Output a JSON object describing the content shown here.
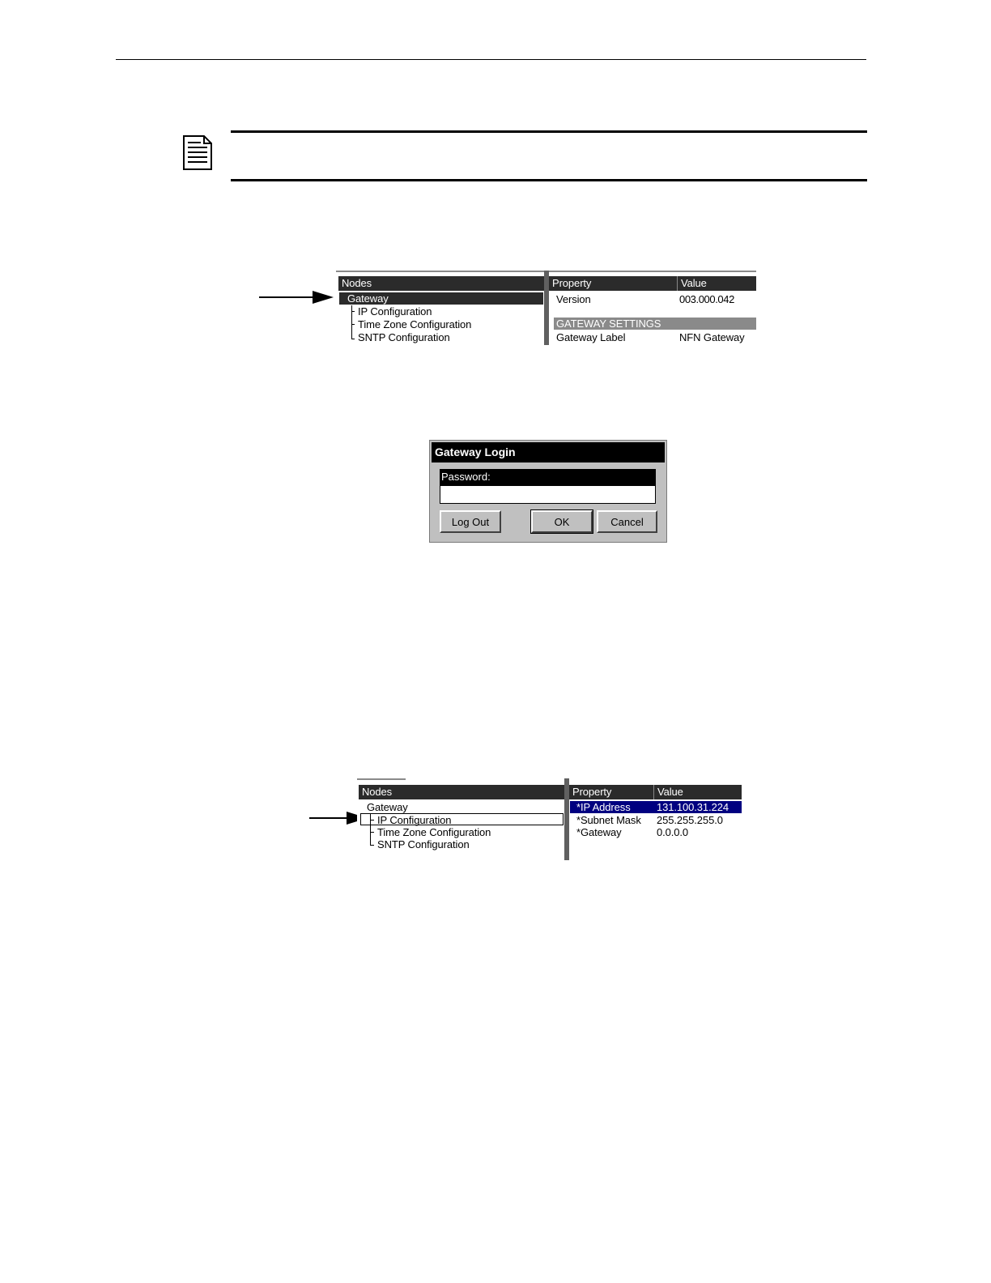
{
  "note_icon": "document-note-icon",
  "shot1": {
    "tree_header": "Nodes",
    "tree_items": [
      "Gateway",
      "IP Configuration",
      "Time Zone Configuration",
      "SNTP Configuration"
    ],
    "prop_header": "Property",
    "value_header": "Value",
    "rows": [
      {
        "property": "Version",
        "value": "003.000.042"
      }
    ],
    "section": "GATEWAY SETTINGS",
    "rows2": [
      {
        "property": "Gateway Label",
        "value": "NFN Gateway"
      }
    ]
  },
  "dialog": {
    "title": "Gateway Login",
    "password_label": "Password:",
    "password_value": "",
    "logout": "Log Out",
    "ok": "OK",
    "cancel": "Cancel"
  },
  "shot2": {
    "tree_header": "Nodes",
    "tree_items": [
      "Gateway",
      "IP Configuration",
      "Time Zone Configuration",
      "SNTP Configuration"
    ],
    "prop_header": "Property",
    "value_header": "Value",
    "rows": [
      {
        "property": "*IP Address",
        "value": "131.100.31.224"
      },
      {
        "property": "*Subnet Mask",
        "value": "255.255.255.0"
      },
      {
        "property": "*Gateway",
        "value": "0.0.0.0"
      }
    ]
  },
  "colors": {
    "selection_blue": "#000080",
    "header_dark": "#2b2b2b",
    "section_gray": "#8a8a8a"
  }
}
